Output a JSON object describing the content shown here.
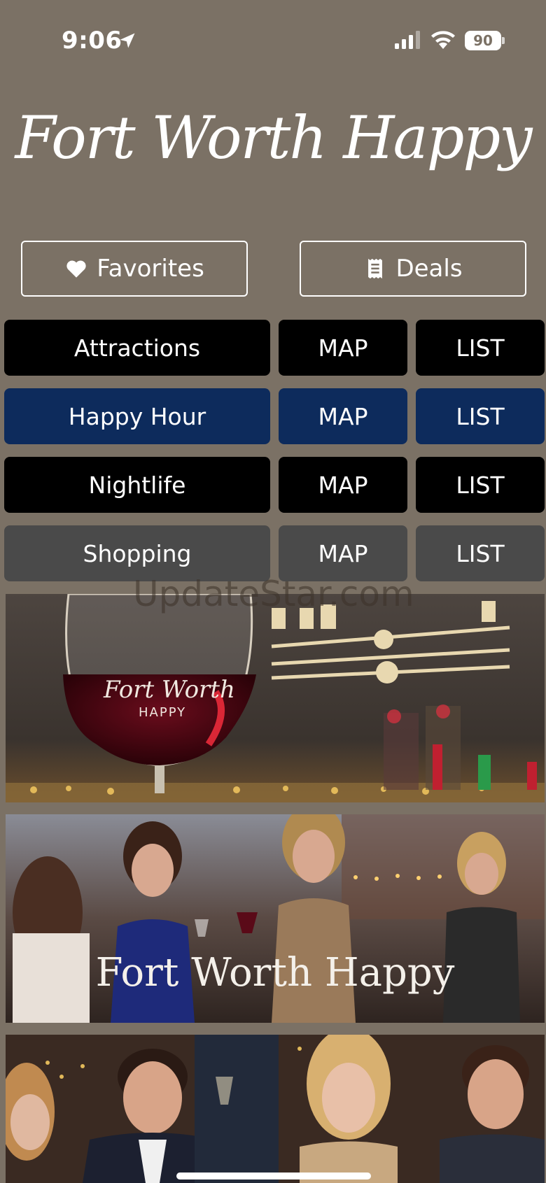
{
  "status_bar": {
    "time": "9:06",
    "battery": "90"
  },
  "app_title": "Fort Worth Happy",
  "top_buttons": {
    "favorites": "Favorites",
    "deals": "Deals"
  },
  "categories": [
    {
      "label": "Attractions",
      "map": "MAP",
      "list": "LIST",
      "color": "#000000"
    },
    {
      "label": "Happy Hour",
      "map": "MAP",
      "list": "LIST",
      "color": "#0d2b5c"
    },
    {
      "label": "Nightlife",
      "map": "MAP",
      "list": "LIST",
      "color": "#000000"
    },
    {
      "label": "Shopping",
      "map": "MAP",
      "list": "LIST",
      "color": "#4a4a4a"
    }
  ],
  "watermark": "UpdateStar.com",
  "banners": [
    {
      "overlay_text": "Fort Worth",
      "overlay_sub": "HAPPY"
    },
    {
      "overlay_text": "Fort Worth Happy"
    },
    {
      "overlay_text": ""
    }
  ]
}
